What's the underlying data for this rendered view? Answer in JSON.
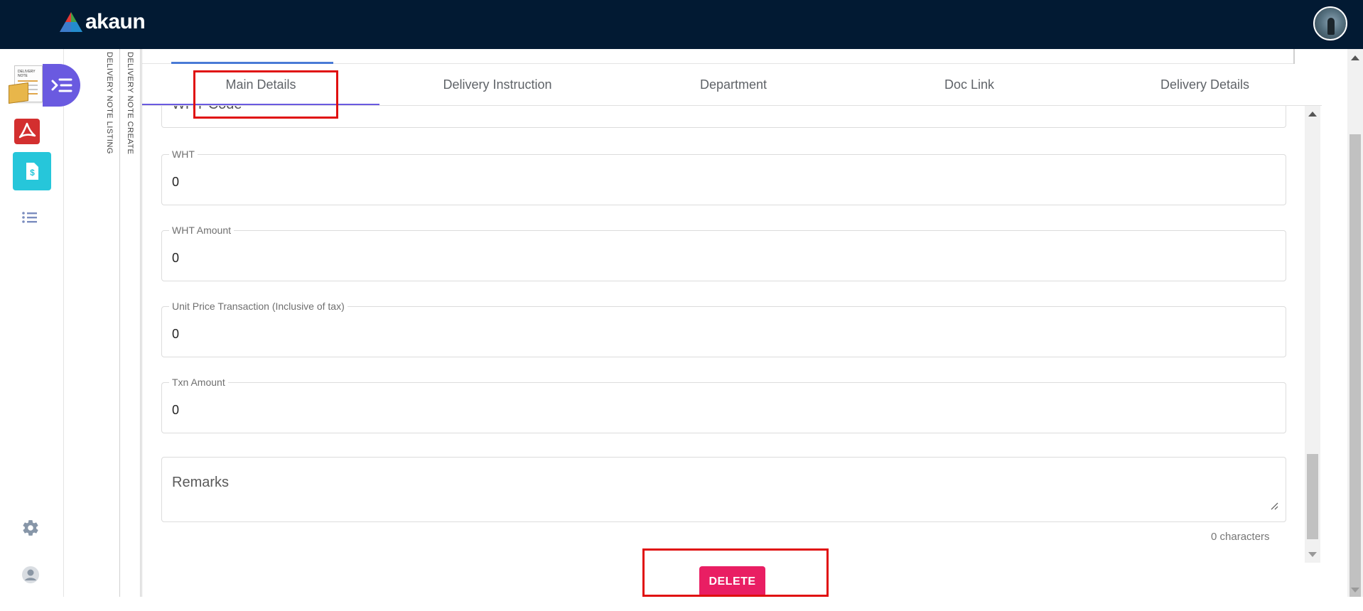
{
  "app": {
    "name": "akaun"
  },
  "nav": {
    "vertical_tabs": [
      "DELIVERY NOTE LISTING",
      "DELIVERY NOTE CREATE"
    ]
  },
  "tabs": [
    "Main Details",
    "Delivery Instruction",
    "Department",
    "Doc Link",
    "Delivery Details"
  ],
  "active_tab": "Main Details",
  "form": {
    "partial_field_value": "WHT Code",
    "fields": [
      {
        "label": "WHT",
        "value": "0"
      },
      {
        "label": "WHT Amount",
        "value": "0"
      },
      {
        "label": "Unit Price Transaction (Inclusive of tax)",
        "value": "0"
      },
      {
        "label": "Txn Amount",
        "value": "0"
      }
    ],
    "remarks_placeholder": "Remarks",
    "char_count": "0 characters"
  },
  "actions": {
    "delete_label": "DELETE"
  },
  "colors": {
    "topbar": "#021a33",
    "accent": "#6a5ae0",
    "delete": "#e91e63",
    "highlight": "#e01010",
    "app_money": "#26c6da",
    "app_pdf": "#d32f2f"
  },
  "icons": [
    "akaun-logo",
    "user-avatar",
    "delivery-note-app-icon",
    "sidenav-toggle-icon",
    "pdf-app-icon",
    "billing-app-icon",
    "list-icon",
    "settings-gear-icon",
    "user-account-icon",
    "resize-grip-icon"
  ]
}
